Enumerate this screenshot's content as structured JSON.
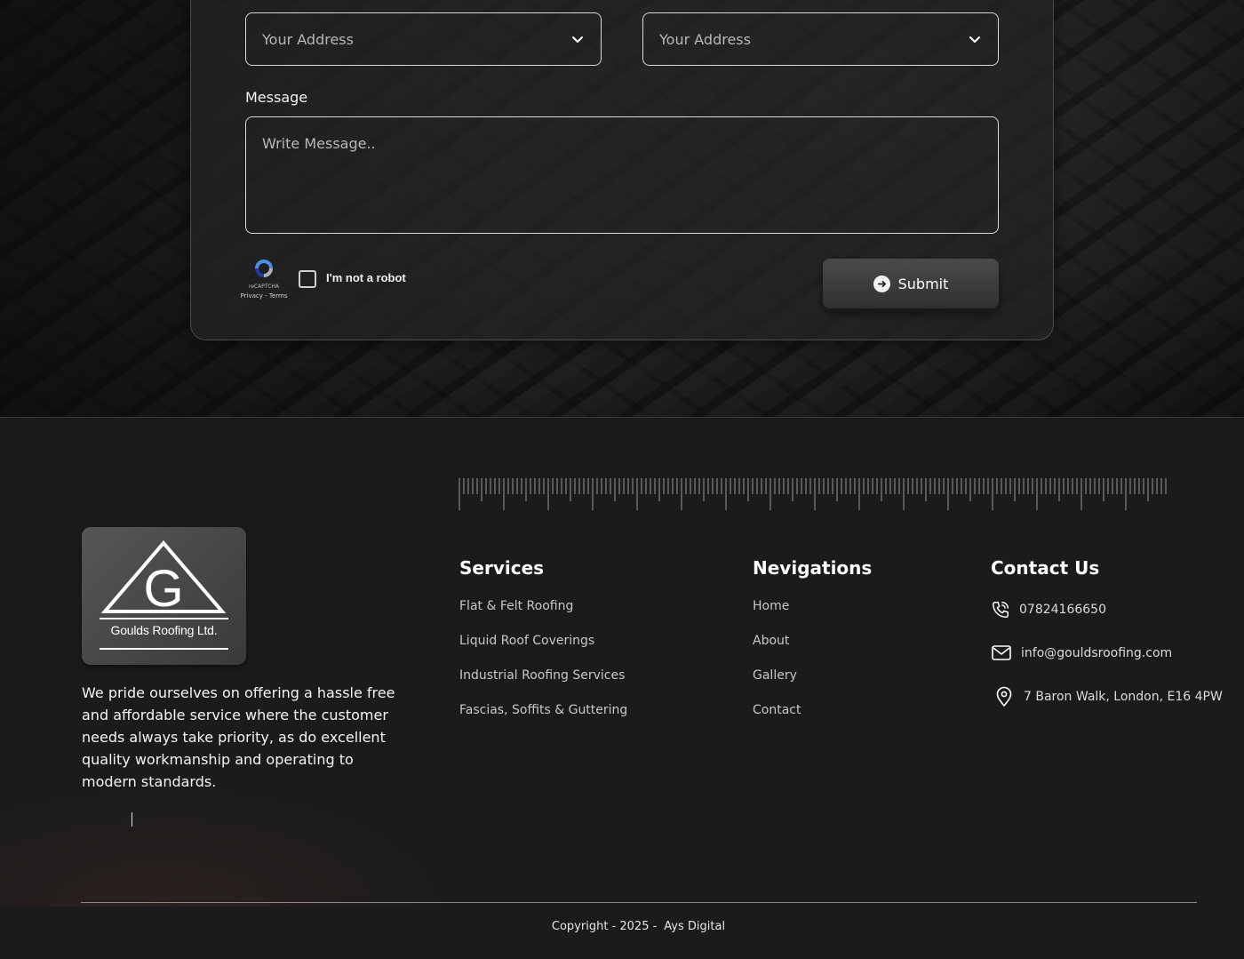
{
  "form": {
    "select_left_placeholder": "Your Address",
    "select_right_placeholder": "Your Address",
    "message_label": "Message",
    "message_placeholder": "Write Message..",
    "recaptcha_brand": "reCAPTCHA",
    "recaptcha_links": "Privacy - Terms",
    "robot_label": "I'm not a robot",
    "submit_label": "Submit"
  },
  "footer": {
    "logo_text": "Goulds Roofing Ltd.",
    "logo_letter": "G",
    "about": "We pride ourselves on offering a hassle free and affordable service where the customer needs always take priority, as do excellent quality workmanship and operating to modern standards.",
    "services": {
      "title": "Services",
      "links": [
        "Flat & Felt Roofing",
        "Liquid Roof Coverings",
        "Industrial Roofing Services",
        "Fascias, Soffits & Guttering"
      ]
    },
    "navigation": {
      "title": "Nevigations",
      "links": [
        "Home",
        "About",
        "Gallery",
        "Contact"
      ]
    },
    "contact": {
      "title": "Contact Us",
      "phone": "07824166650",
      "email": "info@gouldsroofing.com",
      "address": "7 Baron Walk, London, E16 4PW"
    },
    "copyright": "Copyright - 2025 -",
    "brand": "Ays Digital"
  },
  "colors": {
    "background": "#1b1b1b",
    "card": "#242424",
    "text": "#ffffff",
    "muted": "#c8c8c8"
  },
  "icons": [
    "chevron-down-icon",
    "recaptcha-icon",
    "arrow-right-icon",
    "phone-icon",
    "mail-icon",
    "location-pin-icon"
  ]
}
